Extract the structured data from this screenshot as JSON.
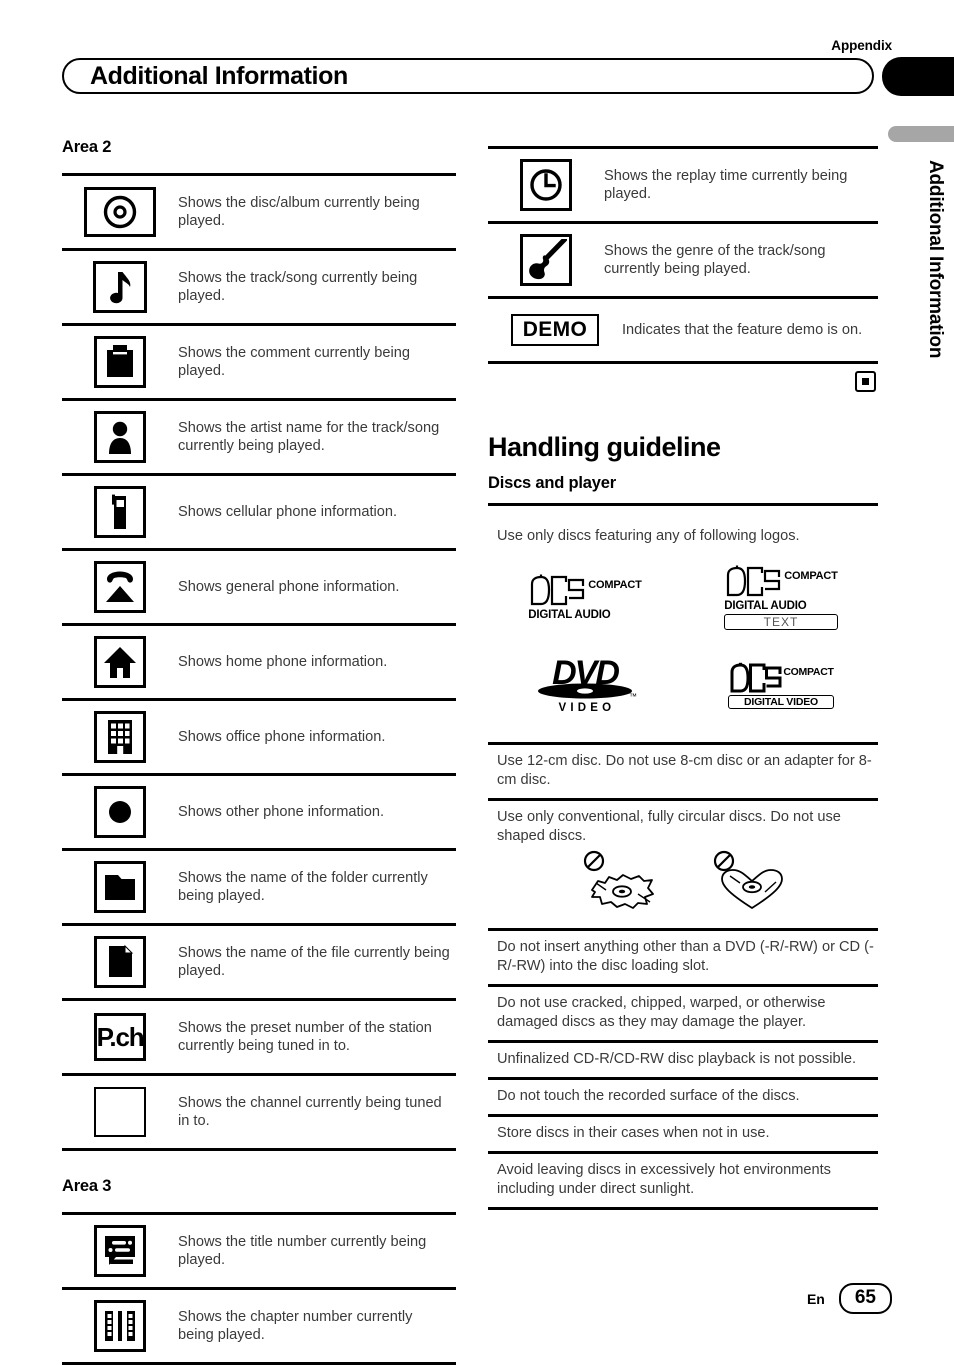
{
  "header": {
    "appendix_label": "Appendix",
    "title": "Additional Information",
    "side_tab": "Additional Information"
  },
  "left_column": {
    "area2": {
      "title": "Area 2",
      "rows": [
        {
          "icon": "disc-album-icon",
          "text": "Shows the disc/album currently being played."
        },
        {
          "icon": "music-note-icon",
          "text": "Shows the track/song currently being played."
        },
        {
          "icon": "comment-clipboard-icon",
          "text": "Shows the comment currently being played."
        },
        {
          "icon": "artist-person-icon",
          "text": "Shows the artist name for  the track/song currently being played."
        },
        {
          "icon": "cellular-phone-icon",
          "text": "Shows cellular phone information."
        },
        {
          "icon": "general-phone-icon",
          "text": "Shows general phone information."
        },
        {
          "icon": "home-phone-icon",
          "text": "Shows home phone information."
        },
        {
          "icon": "office-building-icon",
          "text": "Shows office phone information."
        },
        {
          "icon": "other-phone-dot-icon",
          "text": "Shows other phone information."
        },
        {
          "icon": "folder-icon",
          "text": "Shows the name of the folder currently being played."
        },
        {
          "icon": "file-icon",
          "text": "Shows the name of the file currently being played."
        },
        {
          "icon": "preset-channel-icon",
          "text": "Shows the preset number of the station currently being tuned in to.",
          "label": "P.ch"
        },
        {
          "icon": "blank-box-icon",
          "text": "Shows the channel currently being tuned in to."
        }
      ]
    },
    "area3": {
      "title": "Area 3",
      "rows": [
        {
          "icon": "title-number-icon",
          "text": "Shows the title number currently being played."
        },
        {
          "icon": "chapter-film-icon",
          "text": "Shows the chapter number currently being played."
        }
      ]
    }
  },
  "right_column": {
    "top_rows": [
      {
        "icon": "clock-icon",
        "text": "Shows the replay time currently being played."
      },
      {
        "icon": "guitar-genre-icon",
        "text": "Shows the genre of the track/song currently being played."
      },
      {
        "icon": "demo-badge",
        "label": "DEMO",
        "text": "Indicates that the feature demo is on."
      }
    ],
    "end_marker": "section-end-square",
    "handling": {
      "title": "Handling guideline",
      "subtitle": "Discs and player",
      "logos_intro": "Use only discs featuring any of following logos.",
      "logos": [
        {
          "name": "compact-disc-digital-audio-logo",
          "top": "COMPACT",
          "main": "disc",
          "bottom": "DIGITAL AUDIO"
        },
        {
          "name": "compact-disc-digital-audio-text-logo",
          "top": "COMPACT",
          "main": "disc",
          "bottom": "DIGITAL AUDIO",
          "extra": "TEXT"
        },
        {
          "name": "dvd-video-logo",
          "main": "DVD",
          "bottom": "V I D E O",
          "tm": "™"
        },
        {
          "name": "compact-disc-digital-video-logo",
          "top": "COMPACT",
          "main": "disc",
          "bottom": "DIGITAL VIDEO"
        }
      ],
      "notes": [
        "Use 12-cm disc. Do not use 8-cm disc or an adapter for 8-cm disc.",
        "Use only conventional, fully circular discs. Do not use shaped discs.",
        "Do not insert anything other than a DVD (-R/-RW) or CD (-R/-RW) into the disc loading slot.",
        "Do not use cracked, chipped, warped, or otherwise damaged discs as they may damage the player.",
        "Unfinalized CD-R/CD-RW disc playback is not possible.",
        "Do not touch the recorded surface of the discs.",
        "Store discs in their cases when not in use.",
        "Avoid leaving discs in excessively hot environments including under direct sunlight."
      ],
      "shaped_disc_figures": [
        "prohibited-irregular-shaped-disc-icon",
        "prohibited-heart-shaped-disc-icon"
      ]
    }
  },
  "footer": {
    "language": "En",
    "page_number": "65"
  }
}
